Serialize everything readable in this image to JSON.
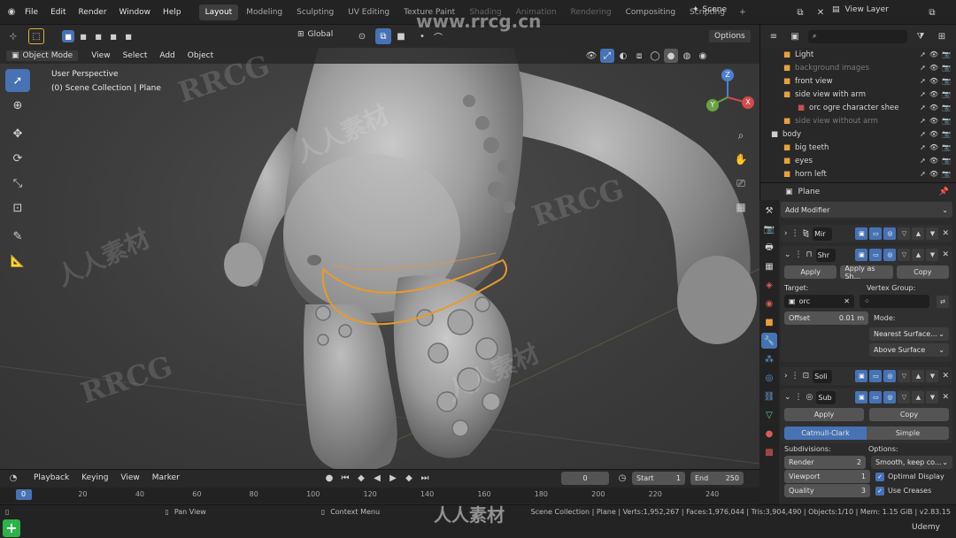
{
  "topbar": {
    "menu": [
      "File",
      "Edit",
      "Render",
      "Window",
      "Help"
    ],
    "workspaces": [
      "Layout",
      "Modeling",
      "Sculpting",
      "UV Editing",
      "Texture Paint",
      "Shading",
      "Animation",
      "Rendering",
      "Compositing",
      "Scripting"
    ],
    "active_workspace": "Layout",
    "add_tab": "+",
    "scene_label": "Scene",
    "view_layer_label": "View Layer"
  },
  "viewport_header": {
    "mode": "Object Mode",
    "menus": [
      "View",
      "Select",
      "Add",
      "Object"
    ],
    "orientation": "Global",
    "options": "Options"
  },
  "viewport": {
    "perspective": "User Perspective",
    "collection": "(0) Scene Collection | Plane",
    "gizmo": {
      "x": "X",
      "y": "Y",
      "z": "Z"
    }
  },
  "outliner": {
    "rows": [
      {
        "name": "Light",
        "dim": false,
        "icon": "light-icon",
        "color": "#e8a23a"
      },
      {
        "name": "background images",
        "dim": true,
        "icon": "empty-icon",
        "color": "#e8a23a"
      },
      {
        "name": "front view",
        "dim": false,
        "icon": "image-empty-icon",
        "color": "#e8a23a"
      },
      {
        "name": "side view with arm",
        "dim": false,
        "icon": "image-empty-icon",
        "color": "#e8a23a"
      },
      {
        "name": "orc ogre character shee",
        "dim": false,
        "icon": "image-icon",
        "color": "#c94f4f"
      },
      {
        "name": "side view without arm",
        "dim": true,
        "icon": "image-empty-icon",
        "color": "#e8a23a"
      },
      {
        "name": "body",
        "dim": false,
        "icon": "collection-icon",
        "color": "#cfcfcf"
      },
      {
        "name": "big teeth",
        "dim": false,
        "icon": "mesh-icon",
        "color": "#e8a23a"
      },
      {
        "name": "eyes",
        "dim": false,
        "icon": "mesh-icon",
        "color": "#e8a23a"
      },
      {
        "name": "horn left",
        "dim": false,
        "icon": "mesh-icon",
        "color": "#e8a23a"
      }
    ]
  },
  "properties": {
    "object_name": "Plane",
    "add_modifier": "Add Modifier",
    "mod1_name": "Mir",
    "mod2": {
      "name": "Shr",
      "apply": "Apply",
      "apply_as": "Apply as Sh...",
      "copy": "Copy",
      "target_label": "Target:",
      "target_value": "orc",
      "vertex_group_label": "Vertex Group:",
      "offset_label": "Offset",
      "offset_value": "0.01 m",
      "mode_label": "Mode:",
      "mode_value": "Nearest Surface...",
      "snap_mode": "Above Surface"
    },
    "mod3_name": "Soli",
    "mod4": {
      "name": "Sub",
      "apply": "Apply",
      "copy": "Copy",
      "catmull": "Catmull-Clark",
      "simple": "Simple",
      "subdiv_label": "Subdivisions:",
      "options_label": "Options:",
      "render_label": "Render",
      "render_value": "2",
      "viewport_label": "Viewport",
      "viewport_value": "1",
      "quality_label": "Quality",
      "quality_value": "3",
      "smooth_value": "Smooth, keep co...",
      "optimal_display": "Optimal Display",
      "use_creases": "Use Creases"
    }
  },
  "timeline": {
    "menus": [
      "Playback",
      "Keying",
      "View",
      "Marker"
    ],
    "current_frame": "0",
    "start_label": "Start",
    "start_value": "1",
    "end_label": "End",
    "end_value": "250",
    "ticks": [
      "0",
      "20",
      "40",
      "60",
      "80",
      "100",
      "120",
      "140",
      "160",
      "180",
      "200",
      "220",
      "240"
    ]
  },
  "statusbar": {
    "pan": "Pan View",
    "context": "Context Menu",
    "stats": "Scene Collection | Plane | Verts:1,952,267 | Faces:1,976,044 | Tris:3,904,490 | Objects:1/10 | Mem: 1.15 GiB | v2.83.15"
  },
  "watermarks": {
    "url": "www.rrcg.cn",
    "brand": "RRCG",
    "cn": "人人素材",
    "udemy": "Udemy"
  }
}
